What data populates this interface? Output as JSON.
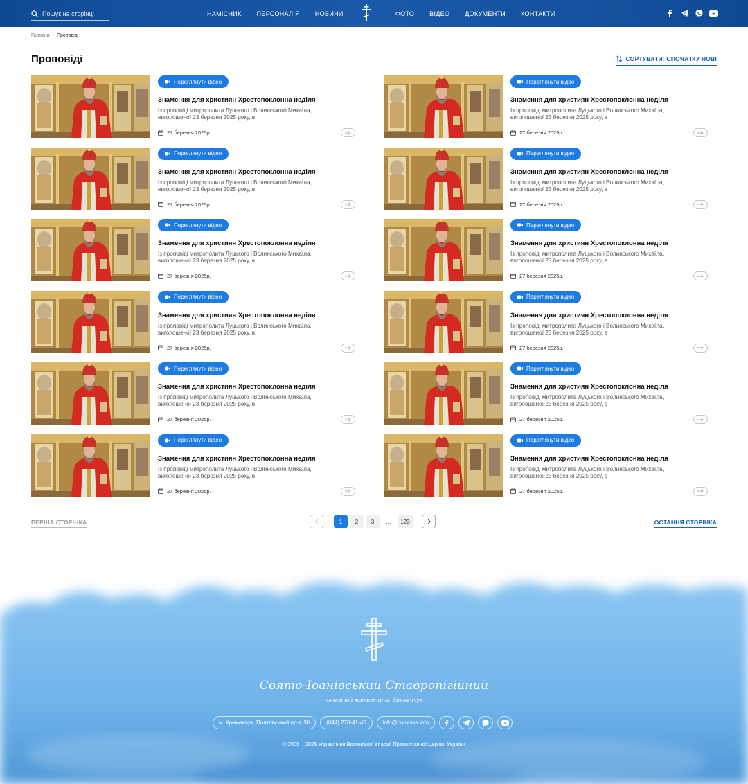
{
  "header": {
    "search_placeholder": "Пошук на сторінці",
    "nav_left": [
      "НАМІСНИК",
      "ПЕРСОНАЛІЯ",
      "НОВИНИ"
    ],
    "nav_right": [
      "ФОТО",
      "ВІДЕО",
      "ДОКУМЕНТИ",
      "КОНТАКТИ"
    ],
    "socials": [
      "facebook-icon",
      "telegram-icon",
      "viber-icon",
      "youtube-icon"
    ]
  },
  "breadcrumb": {
    "home": "Головна",
    "separator": "›",
    "current": "Проповіді"
  },
  "page": {
    "title": "Проповіді",
    "sort_label": "СОРТУВАТИ: СПОЧАТКУ НОВІ"
  },
  "card": {
    "badge": "Переглянути відео",
    "title": "Знамення для християн Хрестопоклонна неділя",
    "desc": "Із проповіді митрополита Луцького і Волинського Михаїла, виголошеної 23 березня 2025 року, в",
    "date": "27 березня 2025р."
  },
  "pagination": {
    "first": "ПЕРША СТОРІНКА",
    "last": "ОСТАННЯ СТОРІНКА",
    "pages": [
      "1",
      "2",
      "3"
    ],
    "ellipsis": "...",
    "final": "123",
    "active": "1"
  },
  "footer": {
    "name": "Свято-Іоанівський Ставропігійний",
    "subtitle": "чоловічий монастир м. Кременчук",
    "address": "м. Кременчук, Полтавський пр-т, 30",
    "phone": "(044) 278-41-45",
    "email": "info@pomisna.info",
    "copyright": "© 2005 – 2025 Управління Волинської єпархії Православної Церкви України"
  },
  "colors": {
    "header": "#0f4a96",
    "accent": "#1e7be0",
    "footer_sky": "#7fbcef"
  }
}
